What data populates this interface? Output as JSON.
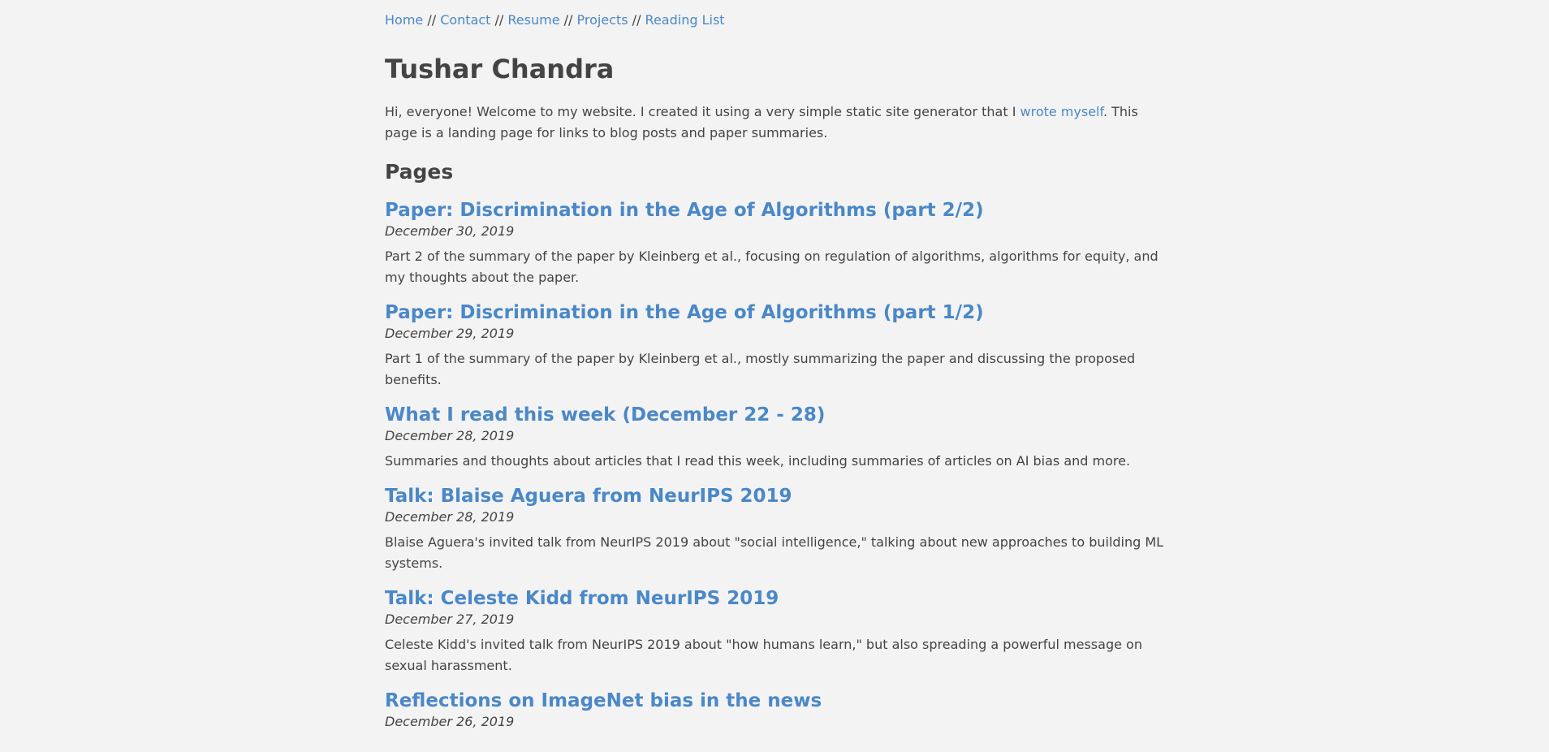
{
  "nav": {
    "items": [
      {
        "label": "Home"
      },
      {
        "label": "Contact"
      },
      {
        "label": "Resume"
      },
      {
        "label": "Projects"
      },
      {
        "label": "Reading List"
      }
    ],
    "separator": " // "
  },
  "header": {
    "title": "Tushar Chandra"
  },
  "intro": {
    "before_link": "Hi, everyone! Welcome to my website. I created it using a very simple static site generator that I ",
    "link_text": "wrote myself",
    "after_link": ". This page is a landing page for links to blog posts and paper summaries."
  },
  "pages": {
    "heading": "Pages",
    "posts": [
      {
        "title": "Paper: Discrimination in the Age of Algorithms (part 2/2)",
        "date": "December 30, 2019",
        "description": "Part 2 of the summary of the paper by Kleinberg et al., focusing on regulation of algorithms, algorithms for equity, and my thoughts about the paper."
      },
      {
        "title": "Paper: Discrimination in the Age of Algorithms (part 1/2)",
        "date": "December 29, 2019",
        "description": "Part 1 of the summary of the paper by Kleinberg et al., mostly summarizing the paper and discussing the proposed benefits."
      },
      {
        "title": "What I read this week (December 22 - 28)",
        "date": "December 28, 2019",
        "description": "Summaries and thoughts about articles that I read this week, including summaries of articles on AI bias and more."
      },
      {
        "title": "Talk: Blaise Aguera from NeurIPS 2019",
        "date": "December 28, 2019",
        "description": "Blaise Aguera's invited talk from NeurIPS 2019 about \"social intelligence,\" talking about new approaches to building ML systems."
      },
      {
        "title": "Talk: Celeste Kidd from NeurIPS 2019",
        "date": "December 27, 2019",
        "description": "Celeste Kidd's invited talk from NeurIPS 2019 about \"how humans learn,\" but also spreading a powerful message on sexual harassment."
      },
      {
        "title": "Reflections on ImageNet bias in the news",
        "date": "December 26, 2019",
        "description": ""
      }
    ]
  },
  "colors": {
    "background": "#f3f3f3",
    "text": "#444444",
    "link": "#4a88c7"
  }
}
